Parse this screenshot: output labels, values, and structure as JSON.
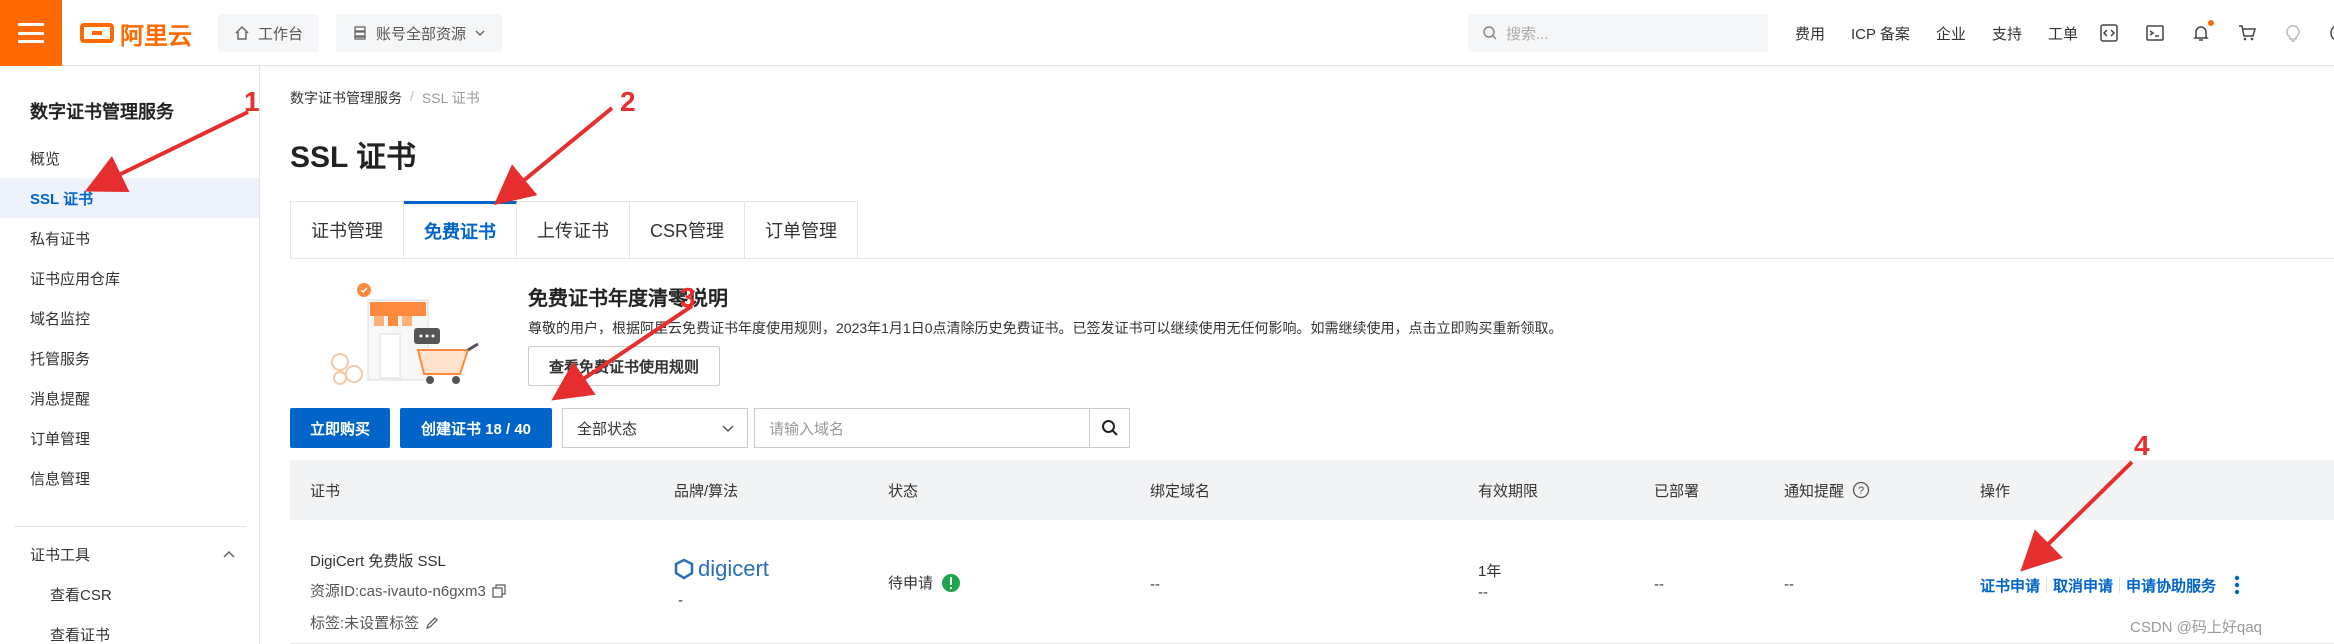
{
  "topbar": {
    "logo_text": "阿里云",
    "workbench": "工作台",
    "resources": "账号全部资源",
    "search_placeholder": "搜索...",
    "links": [
      "费用",
      "ICP 备案",
      "企业",
      "支持",
      "工单"
    ],
    "accent": "#ff6a00"
  },
  "sidebar": {
    "title": "数字证书管理服务",
    "items": [
      "概览",
      "SSL 证书",
      "私有证书",
      "证书应用仓库",
      "域名监控",
      "托管服务",
      "消息提醒",
      "订单管理",
      "信息管理"
    ],
    "active_item": "SSL 证书",
    "group": "证书工具",
    "sub_items": [
      "查看CSR",
      "查看证书"
    ]
  },
  "main": {
    "breadcrumb": [
      "数字证书管理服务",
      "SSL 证书"
    ],
    "title": "SSL 证书",
    "tabs": [
      "证书管理",
      "免费证书",
      "上传证书",
      "CSR管理",
      "订单管理"
    ],
    "active_tab": "免费证书",
    "notice": {
      "title": "免费证书年度清零说明",
      "text": "尊敬的用户，根据阿里云免费证书年度使用规则，2023年1月1日0点清除历史免费证书。已签发证书可以继续使用无任何影响。如需继续使用，点击立即购买重新领取。",
      "button": "查看免费证书使用规则"
    },
    "toolbar": {
      "buy": "立即购买",
      "create": "创建证书 18 / 40",
      "status_select": "全部状态",
      "domain_placeholder": "请输入域名"
    },
    "table": {
      "headers": [
        "证书",
        "品牌/算法",
        "状态",
        "绑定域名",
        "有效期限",
        "已部署",
        "通知提醒",
        "操作"
      ],
      "rows": [
        {
          "name": "DigiCert 免费版 SSL",
          "resource_id": "资源ID:cas-ivauto-n6gxm3",
          "tag": "标签:未设置标签",
          "brand": "digicert",
          "algorithm": "-",
          "status": "待申请",
          "domain": "--",
          "validity": "1年",
          "validity_sub": "--",
          "deployed": "--",
          "notify": "--",
          "actions": [
            "证书申请",
            "取消申请",
            "申请协助服务"
          ]
        }
      ]
    }
  },
  "annotations": [
    "1",
    "2",
    "3",
    "4"
  ],
  "annotation_color": "#e62e2e",
  "watermark": "CSDN @码上好qaq"
}
